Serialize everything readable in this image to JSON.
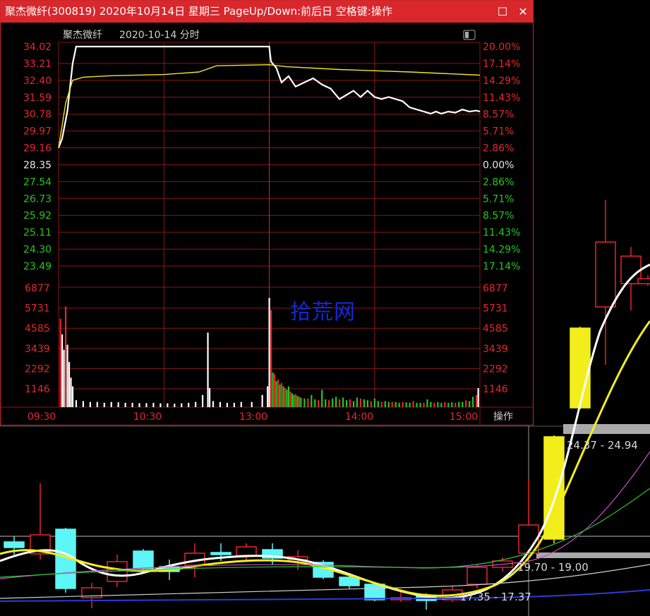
{
  "window": {
    "title": "聚杰微纤(300819) 2020年10月14日 星期三 PageUp/Down:前后日 空格键:操作",
    "restore_icon": "restore-icon",
    "close_icon": "close-icon"
  },
  "header": {
    "stock_name": "聚杰微纤",
    "date_label": "2020-10-14 分时"
  },
  "colors": {
    "red": "#e8262c",
    "green": "#22c81e",
    "white": "#ffffff",
    "yellow": "#f0e61e",
    "grid": "#8a1618",
    "title_bg": "#d9272c"
  },
  "watermark": "拾荒网",
  "chart_data": [
    {
      "type": "line",
      "title": "聚杰微纤 2020-10-14 分时",
      "prev_close": 28.35,
      "ylim": [
        23.49,
        34.02
      ],
      "price_ticks": [
        "34.02",
        "33.21",
        "32.40",
        "31.59",
        "30.78",
        "29.97",
        "29.16",
        "28.35",
        "27.54",
        "26.73",
        "25.92",
        "25.11",
        "24.30",
        "23.49"
      ],
      "pct_ticks": [
        "20.00%",
        "17.14%",
        "14.29%",
        "11.43%",
        "8.57%",
        "5.71%",
        "2.86%",
        "0.00%",
        "2.86%",
        "5.71%",
        "8.57%",
        "11.43%",
        "14.29%",
        "17.14%"
      ],
      "x_labels": [
        "09:30",
        "10:30",
        "13:00",
        "14:00",
        "15:00"
      ],
      "series": [
        {
          "role": "price",
          "points": [
            [
              0,
              29.16
            ],
            [
              2,
              29.6
            ],
            [
              5,
              30.9
            ],
            [
              8,
              33.2
            ],
            [
              10,
              34.02
            ],
            [
              120,
              34.02
            ],
            [
              121,
              33.3
            ],
            [
              124,
              33.0
            ],
            [
              127,
              32.3
            ],
            [
              131,
              32.6
            ],
            [
              135,
              32.1
            ],
            [
              140,
              32.3
            ],
            [
              145,
              32.5
            ],
            [
              150,
              32.2
            ],
            [
              155,
              32.0
            ],
            [
              160,
              31.5
            ],
            [
              164,
              31.7
            ],
            [
              168,
              31.9
            ],
            [
              172,
              31.6
            ],
            [
              176,
              31.9
            ],
            [
              180,
              31.6
            ],
            [
              184,
              31.5
            ],
            [
              188,
              31.6
            ],
            [
              192,
              31.5
            ],
            [
              196,
              31.4
            ],
            [
              200,
              31.1
            ],
            [
              204,
              31.0
            ],
            [
              208,
              30.9
            ],
            [
              212,
              30.8
            ],
            [
              215,
              30.9
            ],
            [
              218,
              30.8
            ],
            [
              222,
              30.9
            ],
            [
              226,
              30.85
            ],
            [
              230,
              31.0
            ],
            [
              234,
              30.9
            ],
            [
              238,
              30.95
            ],
            [
              240,
              30.9
            ]
          ]
        },
        {
          "role": "average",
          "points": [
            [
              0,
              29.16
            ],
            [
              4,
              31.3
            ],
            [
              8,
              32.4
            ],
            [
              14,
              32.55
            ],
            [
              30,
              32.62
            ],
            [
              60,
              32.68
            ],
            [
              80,
              32.8
            ],
            [
              90,
              33.1
            ],
            [
              120,
              33.15
            ],
            [
              130,
              33.05
            ],
            [
              160,
              32.92
            ],
            [
              200,
              32.8
            ],
            [
              240,
              32.65
            ]
          ]
        }
      ],
      "volume": {
        "ylim": [
          0,
          6877
        ],
        "ticks": [
          "6877",
          "5731",
          "4585",
          "3439",
          "2292",
          "1146"
        ],
        "bars": [
          [
            1,
            5100,
            "r"
          ],
          [
            2,
            4200,
            "w"
          ],
          [
            3,
            3300,
            "w"
          ],
          [
            4,
            5800,
            "r"
          ],
          [
            5,
            3600,
            "w"
          ],
          [
            6,
            2600,
            "w"
          ],
          [
            7,
            1700,
            "w"
          ],
          [
            8,
            1200,
            "w"
          ],
          [
            10,
            400,
            "w"
          ],
          [
            14,
            350,
            "w"
          ],
          [
            18,
            300,
            "w"
          ],
          [
            22,
            300,
            "w"
          ],
          [
            26,
            250,
            "w"
          ],
          [
            30,
            300,
            "w"
          ],
          [
            34,
            280,
            "w"
          ],
          [
            38,
            250,
            "w"
          ],
          [
            42,
            250,
            "w"
          ],
          [
            46,
            230,
            "w"
          ],
          [
            50,
            230,
            "w"
          ],
          [
            54,
            250,
            "w"
          ],
          [
            58,
            220,
            "w"
          ],
          [
            62,
            220,
            "w"
          ],
          [
            66,
            200,
            "w"
          ],
          [
            70,
            220,
            "w"
          ],
          [
            74,
            250,
            "w"
          ],
          [
            78,
            300,
            "w"
          ],
          [
            82,
            700,
            "w"
          ],
          [
            85,
            4300,
            "w"
          ],
          [
            86,
            1100,
            "w"
          ],
          [
            88,
            350,
            "w"
          ],
          [
            92,
            300,
            "w"
          ],
          [
            96,
            250,
            "w"
          ],
          [
            100,
            250,
            "w"
          ],
          [
            104,
            300,
            "w"
          ],
          [
            110,
            300,
            "w"
          ],
          [
            116,
            700,
            "w"
          ],
          [
            119,
            1200,
            "w"
          ],
          [
            120,
            6300,
            "w"
          ],
          [
            121,
            5600,
            "r"
          ],
          [
            122,
            2000,
            "g"
          ],
          [
            123,
            1900,
            "r"
          ],
          [
            124,
            1500,
            "g"
          ],
          [
            125,
            1600,
            "r"
          ],
          [
            126,
            1300,
            "g"
          ],
          [
            127,
            1400,
            "r"
          ],
          [
            128,
            1200,
            "g"
          ],
          [
            129,
            1100,
            "r"
          ],
          [
            130,
            1000,
            "g"
          ],
          [
            131,
            1200,
            "g"
          ],
          [
            132,
            900,
            "r"
          ],
          [
            133,
            800,
            "g"
          ],
          [
            134,
            700,
            "g"
          ],
          [
            135,
            750,
            "r"
          ],
          [
            136,
            650,
            "g"
          ],
          [
            137,
            600,
            "r"
          ],
          [
            138,
            550,
            "g"
          ],
          [
            140,
            500,
            "g"
          ],
          [
            142,
            500,
            "r"
          ],
          [
            144,
            700,
            "g"
          ],
          [
            146,
            450,
            "g"
          ],
          [
            148,
            400,
            "r"
          ],
          [
            150,
            1000,
            "g"
          ],
          [
            152,
            450,
            "g"
          ],
          [
            154,
            400,
            "r"
          ],
          [
            156,
            500,
            "g"
          ],
          [
            158,
            600,
            "g"
          ],
          [
            160,
            450,
            "r"
          ],
          [
            162,
            550,
            "g"
          ],
          [
            164,
            400,
            "g"
          ],
          [
            166,
            450,
            "r"
          ],
          [
            168,
            350,
            "g"
          ],
          [
            170,
            550,
            "g"
          ],
          [
            172,
            500,
            "r"
          ],
          [
            174,
            450,
            "g"
          ],
          [
            176,
            400,
            "g"
          ],
          [
            178,
            350,
            "r"
          ],
          [
            180,
            500,
            "g"
          ],
          [
            182,
            350,
            "g"
          ],
          [
            184,
            300,
            "r"
          ],
          [
            186,
            350,
            "g"
          ],
          [
            188,
            300,
            "g"
          ],
          [
            190,
            300,
            "r"
          ],
          [
            192,
            300,
            "g"
          ],
          [
            194,
            250,
            "g"
          ],
          [
            196,
            300,
            "r"
          ],
          [
            198,
            280,
            "g"
          ],
          [
            200,
            250,
            "g"
          ],
          [
            202,
            350,
            "r"
          ],
          [
            204,
            250,
            "g"
          ],
          [
            206,
            250,
            "g"
          ],
          [
            208,
            250,
            "r"
          ],
          [
            210,
            450,
            "g"
          ],
          [
            212,
            300,
            "g"
          ],
          [
            214,
            250,
            "r"
          ],
          [
            216,
            300,
            "g"
          ],
          [
            218,
            250,
            "g"
          ],
          [
            220,
            300,
            "r"
          ],
          [
            222,
            250,
            "g"
          ],
          [
            224,
            280,
            "g"
          ],
          [
            226,
            250,
            "r"
          ],
          [
            228,
            300,
            "g"
          ],
          [
            230,
            300,
            "g"
          ],
          [
            232,
            400,
            "r"
          ],
          [
            234,
            350,
            "g"
          ],
          [
            236,
            600,
            "g"
          ],
          [
            238,
            700,
            "r"
          ],
          [
            239,
            1100,
            "w"
          ]
        ]
      }
    },
    {
      "type": "candlestick",
      "note_labels": [
        "24.37 - 24.94",
        "19.70 - 19.00",
        "17.35 - 17.37"
      ]
    }
  ],
  "corner_label": "操作"
}
